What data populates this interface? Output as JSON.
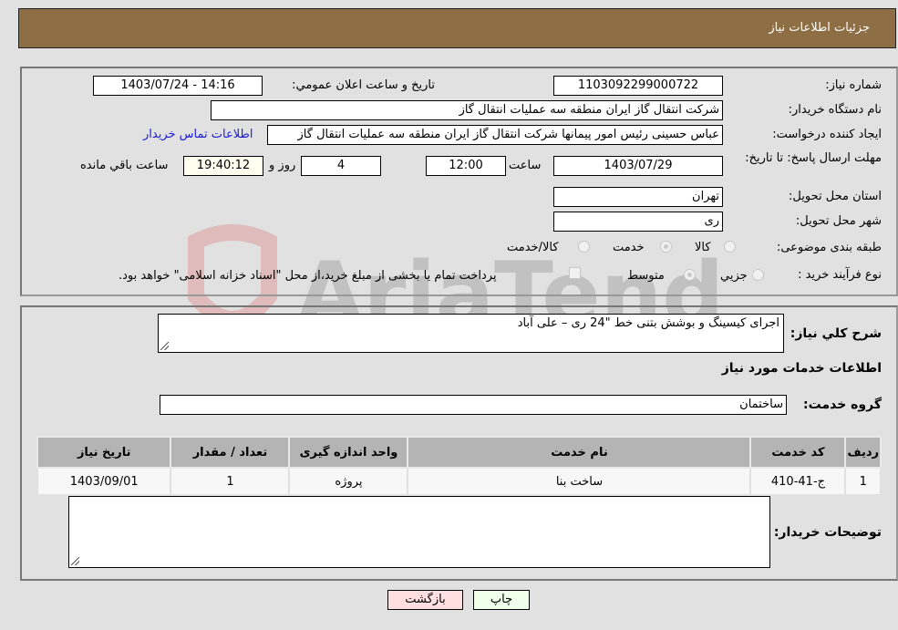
{
  "header": {
    "title": "جزئیات اطلاعات نیاز"
  },
  "form": {
    "need_number_label": "شماره نیاز:",
    "need_number": "1103092299000722",
    "announce_label": "تاریخ و ساعت اعلان عمومي:",
    "announce_value": "1403/07/24 - 14:16",
    "buyer_org_label": "نام دستگاه خریدار:",
    "buyer_org": "شرکت انتقال گاز ایران منطقه سه عملیات انتقال گاز",
    "creator_label": "ایجاد کننده درخواست:",
    "creator": "عباس حسینی رئیس امور پیمانها شرکت انتقال گاز ایران منطقه سه عملیات انتقال گاز",
    "contact_link": "اطلاعات تماس خریدار",
    "deadline_label": "مهلت ارسال پاسخ: تا تاریخ:",
    "deadline_date": "1403/07/29",
    "time_label": "ساعت",
    "deadline_time": "12:00",
    "days_value": "4",
    "days_label": "روز و",
    "remaining_time": "19:40:12",
    "remaining_label": "ساعت باقي مانده",
    "province_label": "استان محل تحویل:",
    "province": "تهران",
    "city_label": "شهر محل تحویل:",
    "city": "ری",
    "category_label": "طبقه بندی موضوعی:",
    "category_options": [
      {
        "label": "کالا",
        "checked": false
      },
      {
        "label": "خدمت",
        "checked": true
      },
      {
        "label": "کالا/خدمت",
        "checked": false
      }
    ],
    "process_label": "نوع فرآیند خرید :",
    "process_options": [
      {
        "label": "جزيي",
        "checked": false
      },
      {
        "label": "متوسط",
        "checked": true
      }
    ],
    "treasury_note": "پرداخت تمام یا بخشی از مبلغ خرید،از محل \"اسناد خزانه اسلامی\" خواهد بود.",
    "treasury_checked": false
  },
  "details": {
    "description_label": "شرح کلي نیاز:",
    "description": "اجرای کیسینگ و بوشش بتنی خط \"24 ری – علی آباد",
    "services_heading": "اطلاعات خدمات مورد نیاز",
    "service_group_label": "گروه خدمت:",
    "service_group": "ساختمان",
    "table": {
      "headers": [
        "ردیف",
        "کد خدمت",
        "نام خدمت",
        "واحد اندازه گیری",
        "تعداد / مقدار",
        "تاریخ نیاز"
      ],
      "rows": [
        [
          "1",
          "ج-41-410",
          "ساخت بنا",
          "پروژه",
          "1",
          "1403/09/01"
        ]
      ]
    },
    "buyer_notes_label": "توضیحات خریدار:",
    "buyer_notes": ""
  },
  "buttons": {
    "print": "چاپ",
    "back": "بازگشت"
  },
  "colors": {
    "header_bg": "#8e6e44",
    "print_bg": "#efffea",
    "back_bg": "#ffdfdf",
    "link": "#1a1ad8"
  }
}
